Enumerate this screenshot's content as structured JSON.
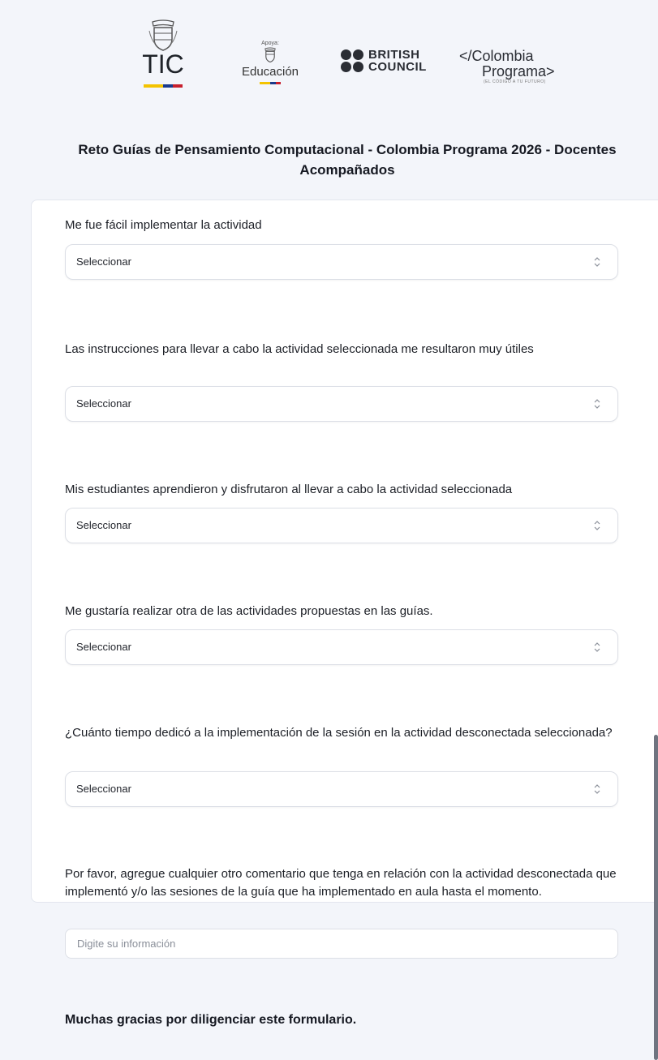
{
  "header": {
    "logos": {
      "tic": {
        "text": "TIC",
        "icon": "coat-of-arms-icon"
      },
      "educacion": {
        "support_label": "Apoya:",
        "text": "Educación",
        "icon": "coat-of-arms-icon"
      },
      "british_council": {
        "line1": "BRITISH",
        "line2": "COUNCIL"
      },
      "colombia_programa": {
        "line1": "</Colombia",
        "line2": "Programa>",
        "tagline": "(EL CÓDIGO A TU FUTURO)"
      }
    },
    "flag_colors": {
      "yellow": "#f3c300",
      "blue": "#1a3a8c",
      "red": "#c7202e"
    }
  },
  "form": {
    "title": "Reto Guías de Pensamiento Computacional - Colombia Programa 2026 - Docentes Acompañados",
    "questions": [
      {
        "label": "Me fue fácil implementar la actividad",
        "type": "select",
        "value": "Seleccionar"
      },
      {
        "label": "Las instrucciones para llevar a cabo la actividad seleccionada me resultaron muy útiles",
        "type": "select",
        "value": "Seleccionar"
      },
      {
        "label": "Mis estudiantes aprendieron y disfrutaron al llevar a cabo la actividad seleccionada",
        "type": "select",
        "value": "Seleccionar"
      },
      {
        "label": "Me gustaría realizar otra de las actividades propuestas en las guías.",
        "type": "select",
        "value": "Seleccionar"
      },
      {
        "label": "¿Cuánto tiempo dedicó a la implementación de la sesión en la actividad desconectada seleccionada?",
        "type": "select",
        "value": "Seleccionar"
      },
      {
        "label": "Por favor, agregue cualquier otro comentario que tenga en relación con la actividad desconectada que implementó y/o las sesiones de la guía que ha implementado en aula hasta el momento.",
        "type": "text",
        "placeholder": "Digite su información"
      }
    ],
    "closing_text": "Muchas gracias por diligenciar este formulario."
  }
}
